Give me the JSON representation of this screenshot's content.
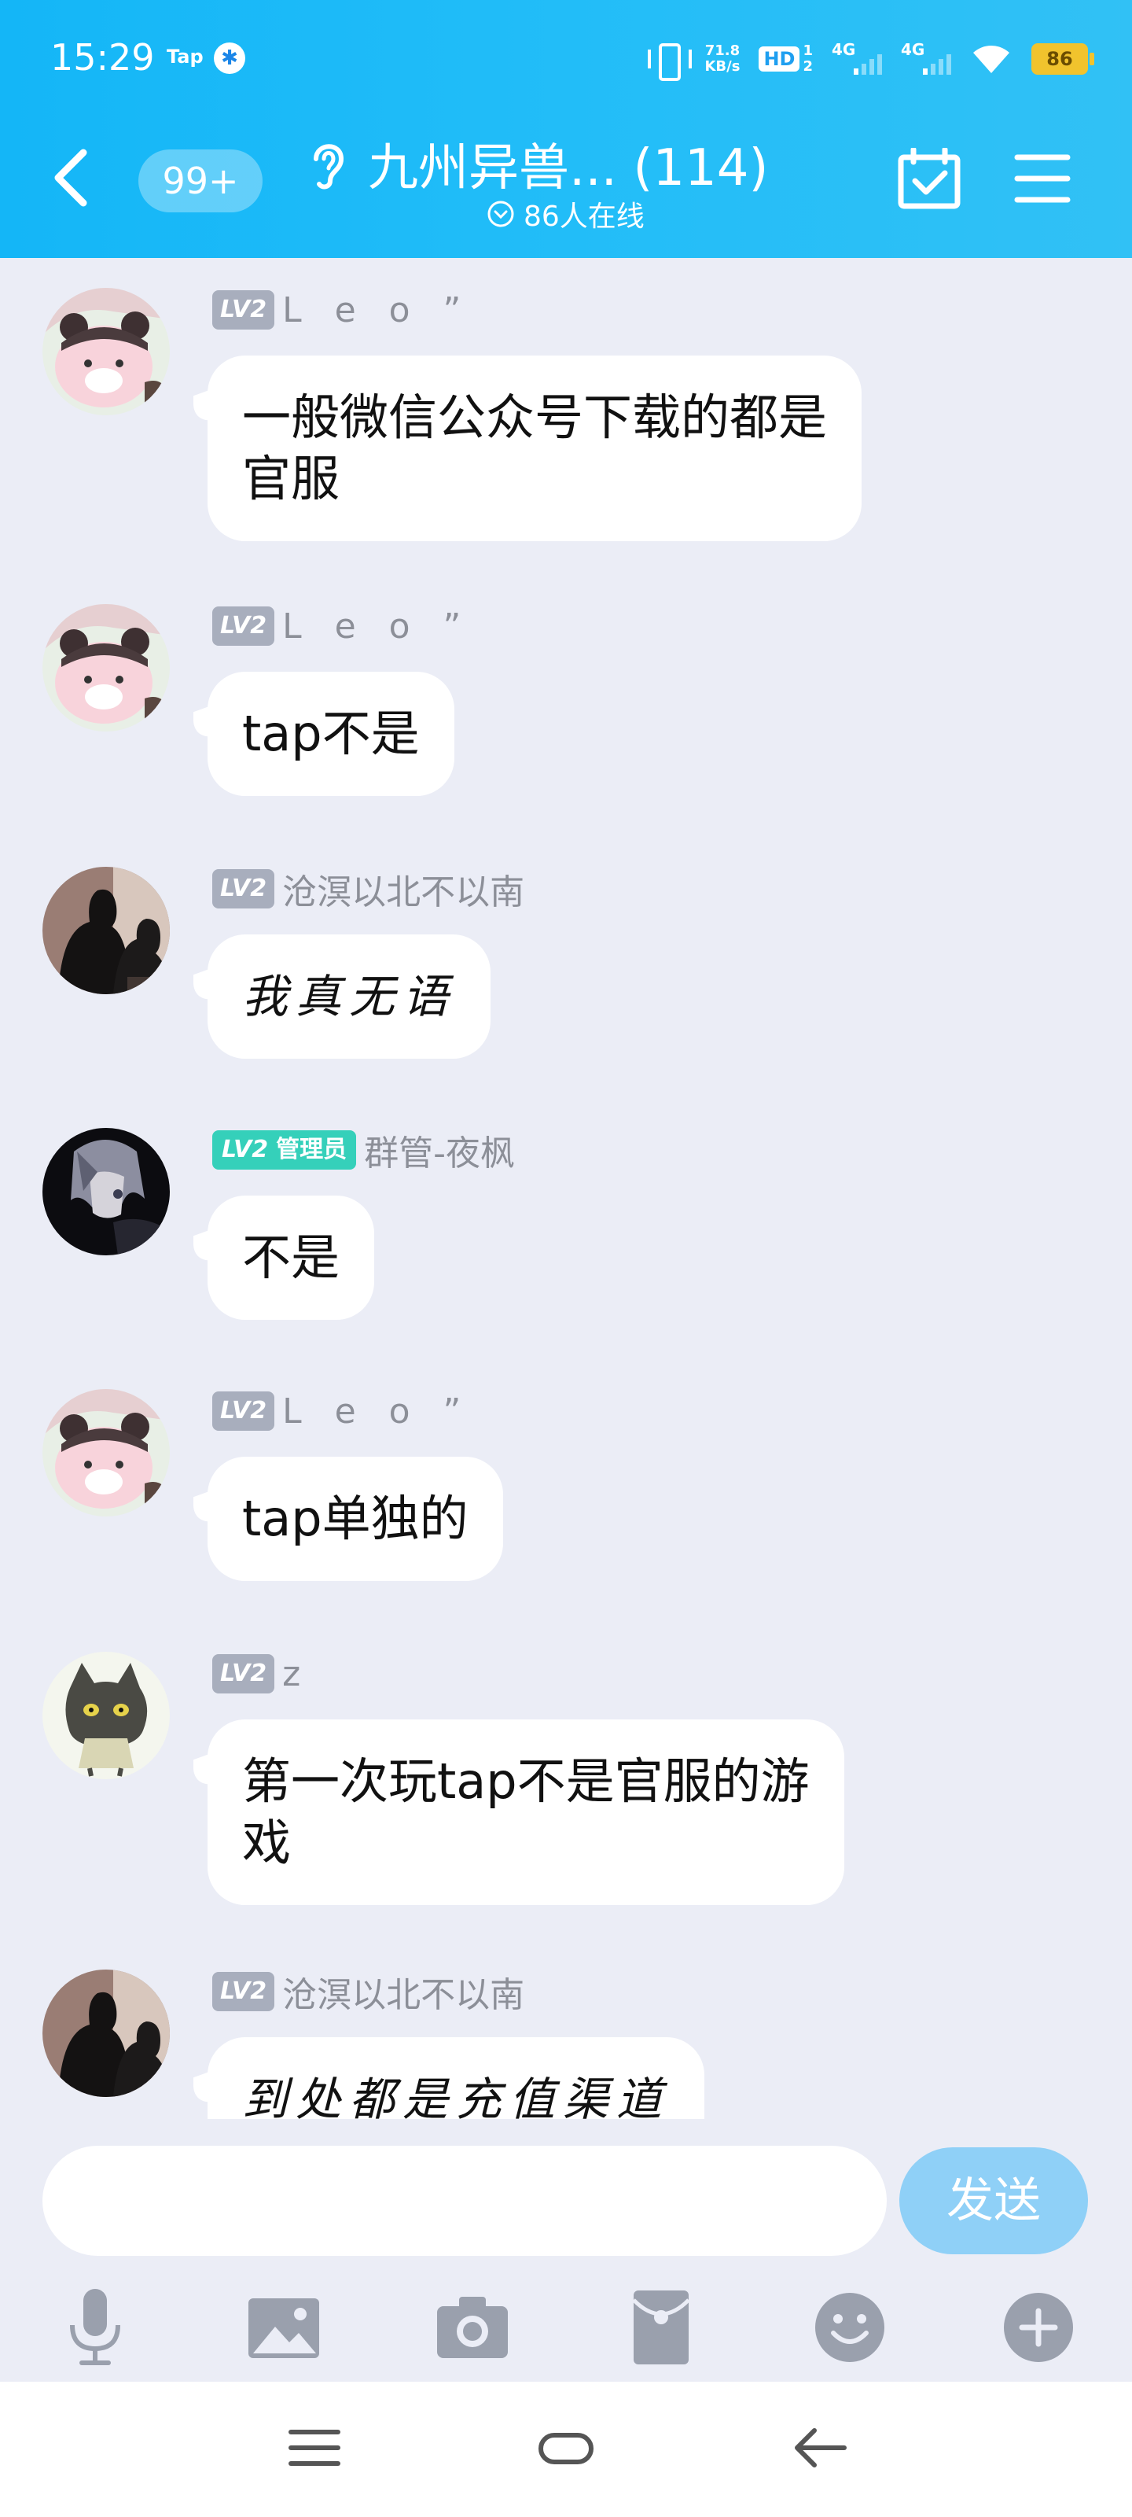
{
  "status_bar": {
    "time": "15:29",
    "app_badge": "Tap",
    "network_speed_value": "71.8",
    "network_speed_unit": "KB/s",
    "hd_label": "HD",
    "hd_sub_top": "1",
    "hd_sub_bottom": "2",
    "sim1_label": "4G",
    "sim2_label": "4G",
    "battery": "86"
  },
  "header": {
    "unread_badge": "99+",
    "title": "九州异兽... (114)",
    "online_text": "86人在线"
  },
  "messages": [
    {
      "level": "LV2",
      "name": "L e o ˮ",
      "text_lines": [
        "一般微信公众号下载的都是",
        "官服"
      ]
    },
    {
      "level": "LV2",
      "name": "L e o ˮ",
      "text_lines": [
        "tap不是"
      ]
    },
    {
      "level": "LV2",
      "name": "沧溟以北不以南",
      "text_lines": [
        "我真无语"
      ]
    },
    {
      "level": "LV2",
      "role": "管理员",
      "name": "群管-夜枫",
      "text_lines": [
        "不是"
      ]
    },
    {
      "level": "LV2",
      "name": "L e o ˮ",
      "text_lines": [
        "tap单独的"
      ]
    },
    {
      "level": "LV2",
      "name": "z",
      "text_lines": [
        "第一次玩tap不是官服的游",
        "戏"
      ]
    },
    {
      "level": "LV2",
      "name": "沧溟以北不以南",
      "text_lines": [
        "到处都是充值渠道"
      ]
    }
  ],
  "input": {
    "value": "",
    "send_label": "发送"
  },
  "toolbar_icons": [
    "microphone-icon",
    "image-icon",
    "camera-icon",
    "red-packet-icon",
    "emoji-icon",
    "plus-icon"
  ],
  "colors": {
    "header_gradient_start": "#14b6f7",
    "header_gradient_end": "#31c1f5",
    "chat_background": "#ebedf6",
    "level_badge": "#a8aebd",
    "admin_badge": "#35d0ba",
    "send_button": "#8fd0f7",
    "battery": "#f1c32d"
  }
}
